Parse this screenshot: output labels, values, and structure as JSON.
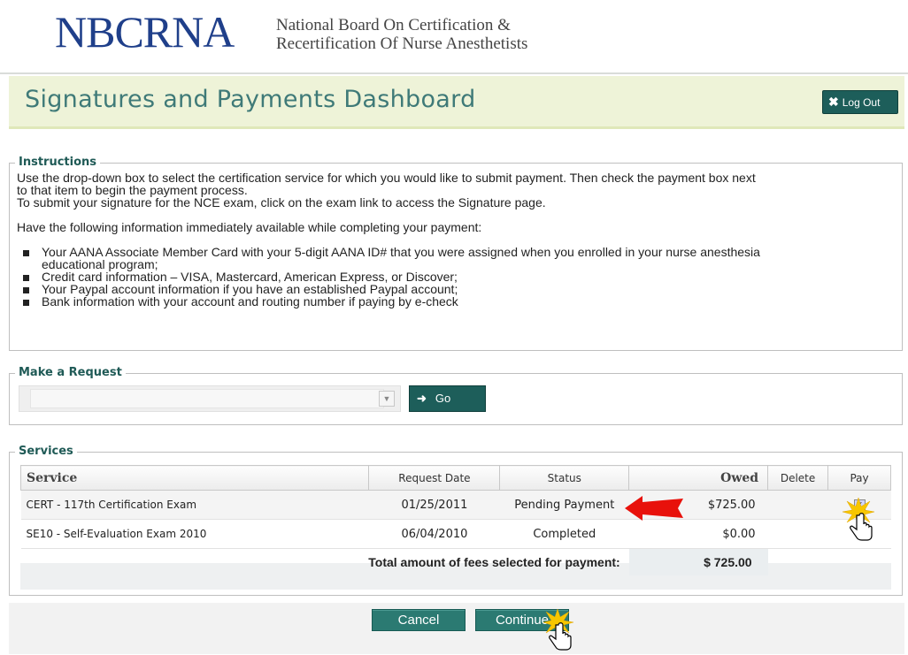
{
  "header": {
    "logo": "NBCRNA",
    "org_line1": "National Board On Certification &",
    "org_line2": "Recertification Of Nurse Anesthetists"
  },
  "title_bar": {
    "title": "Signatures and Payments Dashboard",
    "logout_label": "Log Out",
    "logout_icon": "close-icon"
  },
  "instructions": {
    "legend": "Instructions",
    "para1_line1": "Use the drop-down box to select the certification service for which you would like to submit payment. Then check the payment box next",
    "para1_line2": "to that item to begin the payment process.",
    "para2": "To submit your signature for the NCE exam, click on the exam link to access the Signature page.",
    "para3": "Have the following information immediately available while completing your payment:",
    "items": [
      {
        "line1": "Your AANA Associate Member Card with your 5-digit AANA ID# that you were assigned when you enrolled in your nurse anesthesia",
        "line2": "educational program;"
      },
      {
        "line1": "Credit card information – VISA, Mastercard, American Express, or Discover;",
        "line2": ""
      },
      {
        "line1": "Your Paypal account information if you have an established Paypal account;",
        "line2": ""
      },
      {
        "line1": "Bank information with your account and routing number if paying by e-check",
        "line2": ""
      }
    ]
  },
  "request": {
    "legend": "Make a Request",
    "select_value": "",
    "go_label": "Go"
  },
  "services": {
    "legend": "Services",
    "columns": [
      "Service",
      "Request Date",
      "Status",
      "Owed",
      "Delete",
      "Pay"
    ],
    "rows": [
      {
        "service": "CERT - 117th Certification Exam",
        "date": "01/25/2011",
        "status": "Pending Payment",
        "owed": "$725.00",
        "pay_checked": true
      },
      {
        "service": "SE10 - Self-Evaluation Exam 2010",
        "date": "06/04/2010",
        "status": "Completed",
        "owed": "$0.00",
        "pay_checked": false
      }
    ],
    "total_label": "Total amount of fees selected for payment:",
    "total_value": "$ 725.00"
  },
  "footer": {
    "cancel_label": "Cancel",
    "continue_label": "Continue"
  },
  "colors": {
    "brand_blue": "#1f3f8a",
    "teal": "#1d5e5a",
    "title_bar_bg": "#eef3d8",
    "annotation_red": "#e8110b"
  }
}
